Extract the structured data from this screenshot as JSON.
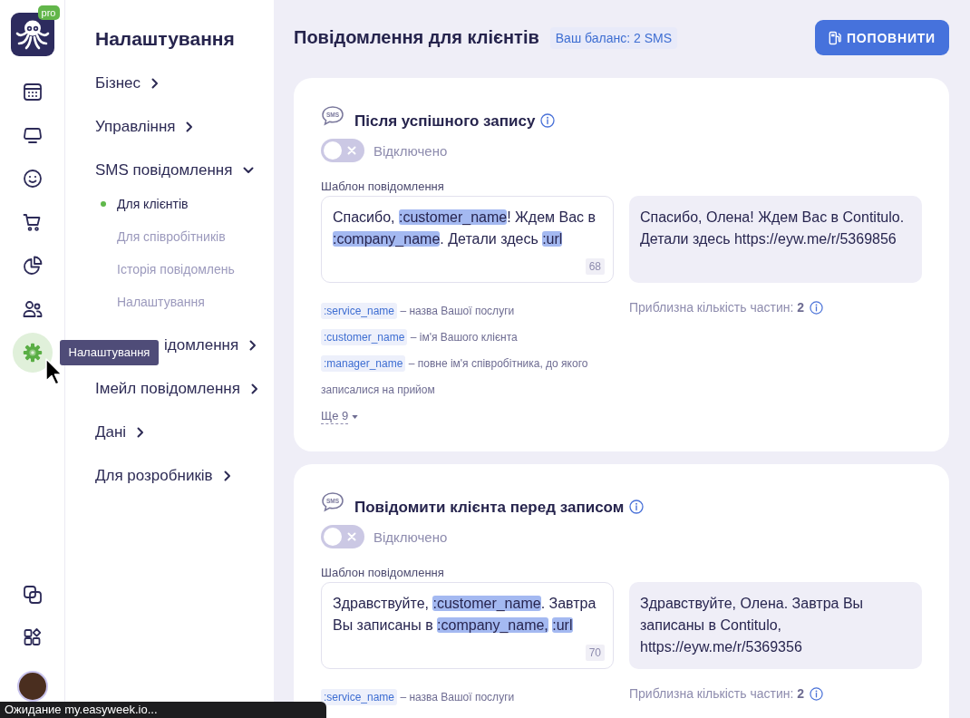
{
  "rail": {
    "logo_badge": "pro",
    "items": [
      {
        "selected": false
      },
      {
        "selected": false
      },
      {
        "selected": false
      },
      {
        "selected": false
      },
      {
        "selected": false
      },
      {
        "selected": false
      },
      {
        "selected": true,
        "tooltip": "Налаштування"
      }
    ],
    "bottom_items": [
      {
        "selected": false
      },
      {
        "selected": false
      }
    ]
  },
  "settings_menu": {
    "title": "Налаштування",
    "items": [
      {
        "label": "Бізнес",
        "expanded": false
      },
      {
        "label": "Управління",
        "expanded": false
      },
      {
        "label": "SMS повідомлення",
        "expanded": true,
        "children": [
          {
            "label": "Для клієнтів",
            "selected": true
          },
          {
            "label": "Для співробітників",
            "selected": false
          },
          {
            "label": "Історія повідомлень",
            "selected": false
          },
          {
            "label": "Налаштування",
            "selected": false
          }
        ]
      },
      {
        "label": "ідомлення",
        "expanded": false,
        "partly_hidden": true
      },
      {
        "label": "Імейл повідомлення",
        "expanded": false
      },
      {
        "label": "Дані",
        "expanded": false
      },
      {
        "label": "Для розробників",
        "expanded": false
      }
    ]
  },
  "header": {
    "title": "Повідомлення для клієнтів",
    "balance": "Ваш баланс: 2 SMS",
    "top_up_button": "ПОПОВНИТИ"
  },
  "cards": [
    {
      "icon_text": "SMS",
      "title": "Після успішного запису",
      "enabled": false,
      "status": "Відключено",
      "template_label": "Шаблон повідомлення",
      "template": [
        {
          "kind": "text",
          "text": "Спасибо, "
        },
        {
          "kind": "variable",
          "text": ":customer_name"
        },
        {
          "kind": "text",
          "text": "! Ждем Вас в "
        },
        {
          "kind": "variable",
          "text": ":company_name"
        },
        {
          "kind": "text",
          "text": ". Детали здесь "
        },
        {
          "kind": "variable",
          "text": ":url"
        }
      ],
      "char_count": "68",
      "preview": "Спасибо, Олена! Ждем Вас в Contitulo. Детали здесь https://eyw.me/r/5369856",
      "parts": "Приблизна кількість частин: **2**",
      "hints": [
        {
          "tag": ":service_name",
          "text": "– назва Вашої послуги"
        },
        {
          "tag": ":customer_name",
          "text": "– ім'я Вашого клієнта"
        },
        {
          "tag": ":manager_name",
          "text": "– повне ім'я співробітника, до якого записалися на прийом"
        }
      ],
      "more": "Ще 9"
    },
    {
      "icon_text": "SMS",
      "title": "Повідомити клієнта перед записом",
      "enabled": false,
      "status": "Відключено",
      "template_label": "Шаблон повідомлення",
      "template": [
        {
          "kind": "text",
          "text": "Здравствуйте, "
        },
        {
          "kind": "variable",
          "text": ":customer_name"
        },
        {
          "kind": "text",
          "text": ". Завтра Вы записаны в "
        },
        {
          "kind": "variable",
          "text": ":company_name,"
        },
        {
          "kind": "space"
        },
        {
          "kind": "variable",
          "text": ":url"
        }
      ],
      "char_count": "70",
      "preview": "Здравствуйте, Олена. Завтра Вы записаны в Contitulo, https://eyw.me/r/5369356",
      "parts": "Приблизна кількість частин: **2**",
      "hints": [
        {
          "tag": ":service_name",
          "text": "– назва Вашої послуги"
        }
      ]
    }
  ],
  "status_bar": {
    "text": "Ожидание my.easyweek.io..."
  }
}
